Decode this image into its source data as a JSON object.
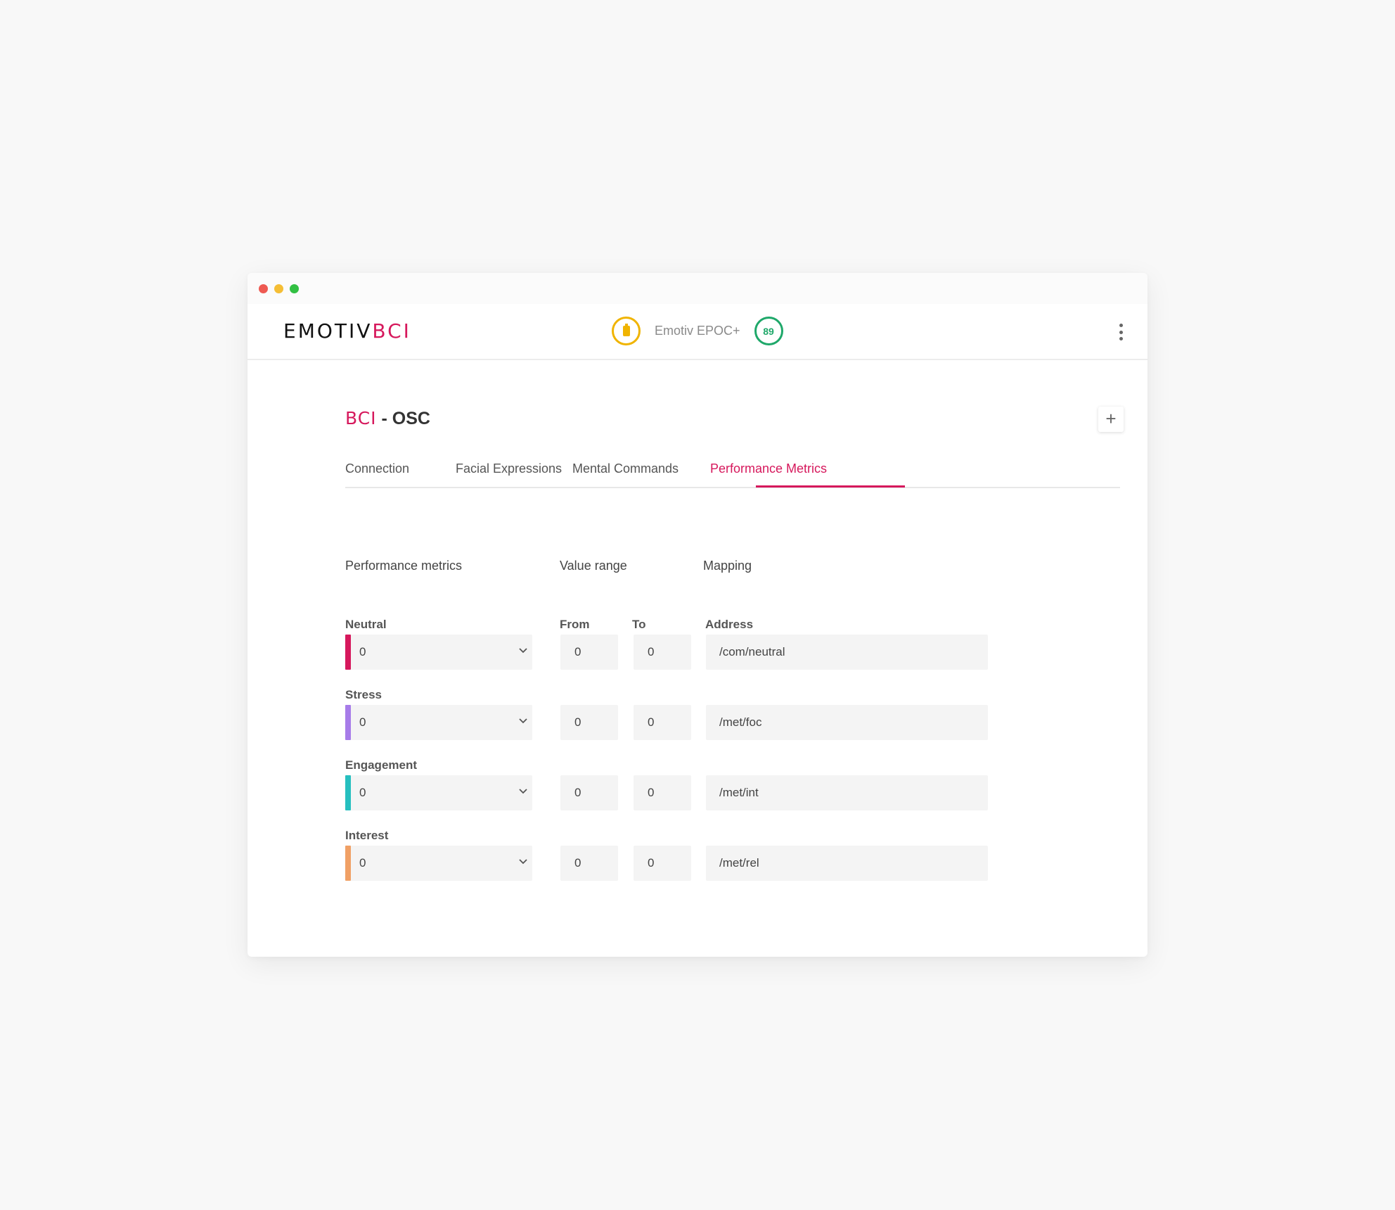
{
  "window": {
    "traffic_lights": [
      "#ee5a52",
      "#f5be35",
      "#32c043"
    ]
  },
  "appbar": {
    "logo_part1": "EMOTIV",
    "logo_part2": "BCI",
    "battery_icon": "battery-icon",
    "device_name": "Emotiv EPOC+",
    "signal_value": "89",
    "menu_icon": "kebab-menu-icon"
  },
  "page": {
    "title_brand": "BCI",
    "title_rest": " - OSC",
    "add_label": "+"
  },
  "tabs": [
    {
      "label": "Connection"
    },
    {
      "label": "Facial Expressions"
    },
    {
      "label": "Mental Commands"
    },
    {
      "label": "Performance Metrics",
      "active": true
    }
  ],
  "table": {
    "headers": {
      "metrics": "Performance metrics",
      "range": "Value range",
      "mapping": "Mapping"
    },
    "subheaders": {
      "from": "From",
      "to": "To",
      "address": "Address"
    },
    "rows": [
      {
        "label": "Neutral",
        "color": "#d6185c",
        "select": "0",
        "from": "0",
        "to": "0",
        "address": "/com/neutral"
      },
      {
        "label": "Stress",
        "color": "#a77ce9",
        "select": "0",
        "from": "0",
        "to": "0",
        "address": "/met/foc"
      },
      {
        "label": "Engagement",
        "color": "#26bfbf",
        "select": "0",
        "from": "0",
        "to": "0",
        "address": "/met/int"
      },
      {
        "label": "Interest",
        "color": "#f0a065",
        "select": "0",
        "from": "0",
        "to": "0",
        "address": "/met/rel"
      }
    ]
  },
  "colors": {
    "accent": "#d6185c",
    "battery": "#f0b400",
    "signal": "#1fa86a"
  }
}
